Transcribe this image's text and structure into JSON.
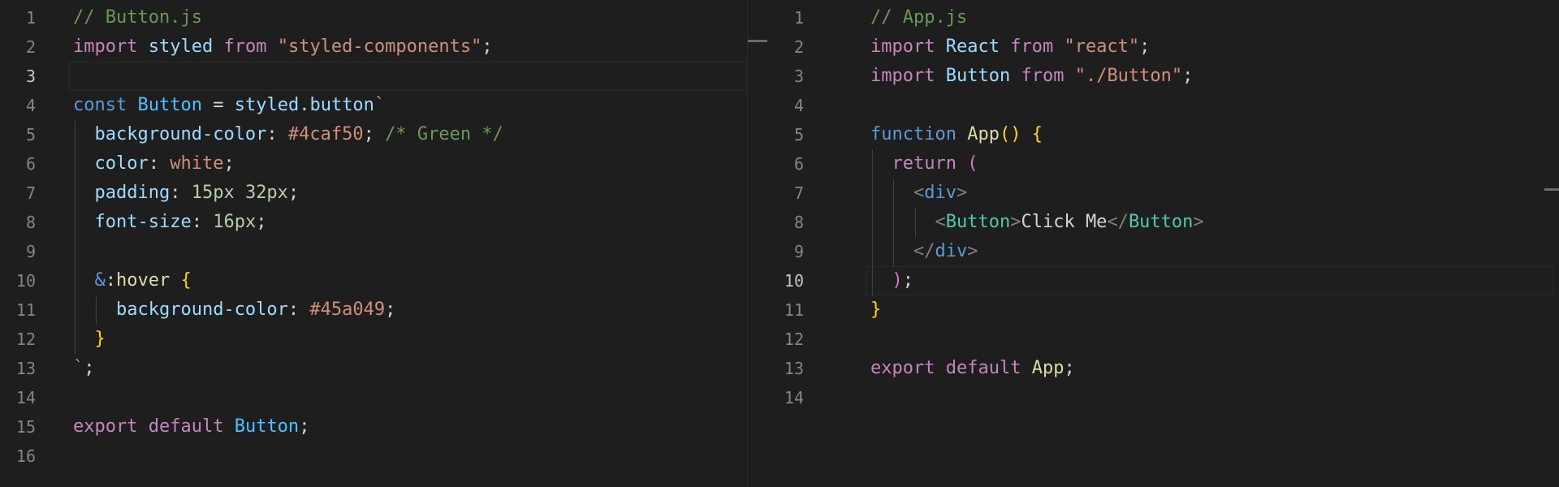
{
  "left_pane": {
    "filename_comment": "// Button.js",
    "line_numbers": [
      "1",
      "2",
      "3",
      "4",
      "5",
      "6",
      "7",
      "8",
      "9",
      "10",
      "11",
      "12",
      "13",
      "14",
      "15",
      "16"
    ],
    "active_line": "3",
    "lines": [
      [
        {
          "t": "// Button.js",
          "c": "comment"
        }
      ],
      [
        {
          "t": "import",
          "c": "keyword"
        },
        {
          "t": " "
        },
        {
          "t": "styled",
          "c": "identifier"
        },
        {
          "t": " "
        },
        {
          "t": "from",
          "c": "keyword"
        },
        {
          "t": " "
        },
        {
          "t": "\"styled-components\"",
          "c": "string"
        },
        {
          "t": ";",
          "c": "punct"
        }
      ],
      [],
      [
        {
          "t": "const",
          "c": "storage"
        },
        {
          "t": " "
        },
        {
          "t": "Button",
          "c": "type"
        },
        {
          "t": " = ",
          "c": "punct"
        },
        {
          "t": "styled",
          "c": "identifier"
        },
        {
          "t": ".",
          "c": "punct"
        },
        {
          "t": "button",
          "c": "identifier"
        },
        {
          "t": "`",
          "c": "template"
        }
      ],
      [
        {
          "t": "  "
        },
        {
          "t": "background-color",
          "c": "css-prop"
        },
        {
          "t": ": ",
          "c": "punct"
        },
        {
          "t": "#4caf50",
          "c": "css-value"
        },
        {
          "t": "; ",
          "c": "punct"
        },
        {
          "t": "/* Green */",
          "c": "comment"
        }
      ],
      [
        {
          "t": "  "
        },
        {
          "t": "color",
          "c": "css-prop"
        },
        {
          "t": ": ",
          "c": "punct"
        },
        {
          "t": "white",
          "c": "css-value"
        },
        {
          "t": ";",
          "c": "punct"
        }
      ],
      [
        {
          "t": "  "
        },
        {
          "t": "padding",
          "c": "css-prop"
        },
        {
          "t": ": ",
          "c": "punct"
        },
        {
          "t": "15px 32px",
          "c": "number"
        },
        {
          "t": ";",
          "c": "punct"
        }
      ],
      [
        {
          "t": "  "
        },
        {
          "t": "font-size",
          "c": "css-prop"
        },
        {
          "t": ": ",
          "c": "punct"
        },
        {
          "t": "16px",
          "c": "number"
        },
        {
          "t": ";",
          "c": "punct"
        }
      ],
      [],
      [
        {
          "t": "  "
        },
        {
          "t": "&",
          "c": "storage"
        },
        {
          "t": ":hover",
          "c": "func"
        },
        {
          "t": " "
        },
        {
          "t": "{",
          "c": "brace-yellow"
        }
      ],
      [
        {
          "t": "    "
        },
        {
          "t": "background-color",
          "c": "css-prop"
        },
        {
          "t": ": ",
          "c": "punct"
        },
        {
          "t": "#45a049",
          "c": "css-value"
        },
        {
          "t": ";",
          "c": "punct"
        }
      ],
      [
        {
          "t": "  "
        },
        {
          "t": "}",
          "c": "brace-yellow"
        }
      ],
      [
        {
          "t": "`",
          "c": "template"
        },
        {
          "t": ";",
          "c": "punct"
        }
      ],
      [],
      [
        {
          "t": "export",
          "c": "keyword"
        },
        {
          "t": " "
        },
        {
          "t": "default",
          "c": "keyword"
        },
        {
          "t": " "
        },
        {
          "t": "Button",
          "c": "type"
        },
        {
          "t": ";",
          "c": "punct"
        }
      ],
      []
    ]
  },
  "right_pane": {
    "filename_comment": "// App.js",
    "line_numbers": [
      "1",
      "2",
      "3",
      "4",
      "5",
      "6",
      "7",
      "8",
      "9",
      "10",
      "11",
      "12",
      "13",
      "14"
    ],
    "active_line": "10",
    "lines": [
      [
        {
          "t": "// App.js",
          "c": "comment"
        }
      ],
      [
        {
          "t": "import",
          "c": "keyword"
        },
        {
          "t": " "
        },
        {
          "t": "React",
          "c": "identifier"
        },
        {
          "t": " "
        },
        {
          "t": "from",
          "c": "keyword"
        },
        {
          "t": " "
        },
        {
          "t": "\"react\"",
          "c": "string"
        },
        {
          "t": ";",
          "c": "punct"
        }
      ],
      [
        {
          "t": "import",
          "c": "keyword"
        },
        {
          "t": " "
        },
        {
          "t": "Button",
          "c": "identifier"
        },
        {
          "t": " "
        },
        {
          "t": "from",
          "c": "keyword"
        },
        {
          "t": " "
        },
        {
          "t": "\"./Button\"",
          "c": "string"
        },
        {
          "t": ";",
          "c": "punct"
        }
      ],
      [],
      [
        {
          "t": "function",
          "c": "storage"
        },
        {
          "t": " "
        },
        {
          "t": "App",
          "c": "func"
        },
        {
          "t": "()",
          "c": "brace-yellow"
        },
        {
          "t": " "
        },
        {
          "t": "{",
          "c": "brace-yellow"
        }
      ],
      [
        {
          "t": "  "
        },
        {
          "t": "return",
          "c": "keyword"
        },
        {
          "t": " "
        },
        {
          "t": "(",
          "c": "brace-pink"
        }
      ],
      [
        {
          "t": "    "
        },
        {
          "t": "<",
          "c": "tag-bracket"
        },
        {
          "t": "div",
          "c": "html-tag"
        },
        {
          "t": ">",
          "c": "tag-bracket"
        }
      ],
      [
        {
          "t": "      "
        },
        {
          "t": "<",
          "c": "tag-bracket"
        },
        {
          "t": "Button",
          "c": "tag"
        },
        {
          "t": ">",
          "c": "tag-bracket"
        },
        {
          "t": "Click Me",
          "c": "punct"
        },
        {
          "t": "</",
          "c": "tag-bracket"
        },
        {
          "t": "Button",
          "c": "tag"
        },
        {
          "t": ">",
          "c": "tag-bracket"
        }
      ],
      [
        {
          "t": "    "
        },
        {
          "t": "</",
          "c": "tag-bracket"
        },
        {
          "t": "div",
          "c": "html-tag"
        },
        {
          "t": ">",
          "c": "tag-bracket"
        }
      ],
      [
        {
          "t": "  "
        },
        {
          "t": ")",
          "c": "brace-pink"
        },
        {
          "t": ";",
          "c": "punct"
        }
      ],
      [
        {
          "t": "}",
          "c": "brace-yellow"
        }
      ],
      [],
      [
        {
          "t": "export",
          "c": "keyword"
        },
        {
          "t": " "
        },
        {
          "t": "default",
          "c": "keyword"
        },
        {
          "t": " "
        },
        {
          "t": "App",
          "c": "func"
        },
        {
          "t": ";",
          "c": "punct"
        }
      ],
      []
    ]
  }
}
